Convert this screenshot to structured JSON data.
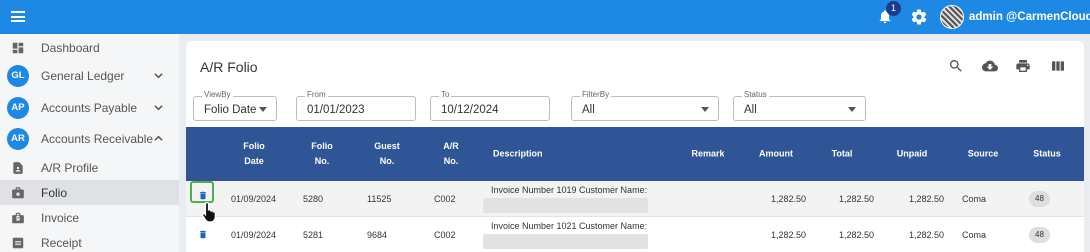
{
  "topbar": {
    "notification_count": "1",
    "user_label": "admin @CarmenCloud",
    "accent_color": "#1e88e5"
  },
  "sidebar": {
    "items": [
      {
        "label": "Dashboard",
        "icon": "dashboard-icon"
      },
      {
        "label": "General Ledger",
        "badge": "GL"
      },
      {
        "label": "Accounts Payable",
        "badge": "AP"
      },
      {
        "label": "Accounts Receivable",
        "badge": "AR"
      },
      {
        "label": "A/R Profile",
        "icon": "profile-icon"
      },
      {
        "label": "Folio",
        "icon": "folio-icon",
        "active": true
      },
      {
        "label": "Invoice",
        "icon": "invoice-icon"
      },
      {
        "label": "Receipt",
        "icon": "receipt-icon"
      }
    ]
  },
  "page": {
    "title": "A/R Folio"
  },
  "filters": {
    "viewby": {
      "label": "ViewBy",
      "value": "Folio Date"
    },
    "from": {
      "label": "From",
      "value": "01/01/2023"
    },
    "to": {
      "label": "To",
      "value": "10/12/2024"
    },
    "filterby": {
      "label": "FilterBy",
      "value": "All"
    },
    "status": {
      "label": "Status",
      "value": "All"
    }
  },
  "table": {
    "headers": [
      [
        "Folio",
        "Date"
      ],
      [
        "Folio",
        "No."
      ],
      [
        "Guest",
        "No."
      ],
      [
        "A/R",
        "No."
      ],
      [
        "Description"
      ],
      [
        "Remark"
      ],
      [
        "Amount"
      ],
      [
        "Total"
      ],
      [
        "Unpaid"
      ],
      [
        "Source"
      ],
      [
        "Status"
      ]
    ],
    "rows": [
      {
        "date": "01/09/2024",
        "folio": "5280",
        "guest": "11525",
        "ar": "C002",
        "desc": "Invoice Number 1019 Customer Name:",
        "remark": "",
        "amount": "1,282.50",
        "total": "1,282.50",
        "unpaid": "1,282.50",
        "source": "Coma",
        "status": "48"
      },
      {
        "date": "01/09/2024",
        "folio": "5281",
        "guest": "9684",
        "ar": "C002",
        "desc": "Invoice Number 1021 Customer Name:",
        "remark": "",
        "amount": "1,282.50",
        "total": "1,282.50",
        "unpaid": "1,282.50",
        "source": "Coma",
        "status": "48"
      }
    ]
  }
}
